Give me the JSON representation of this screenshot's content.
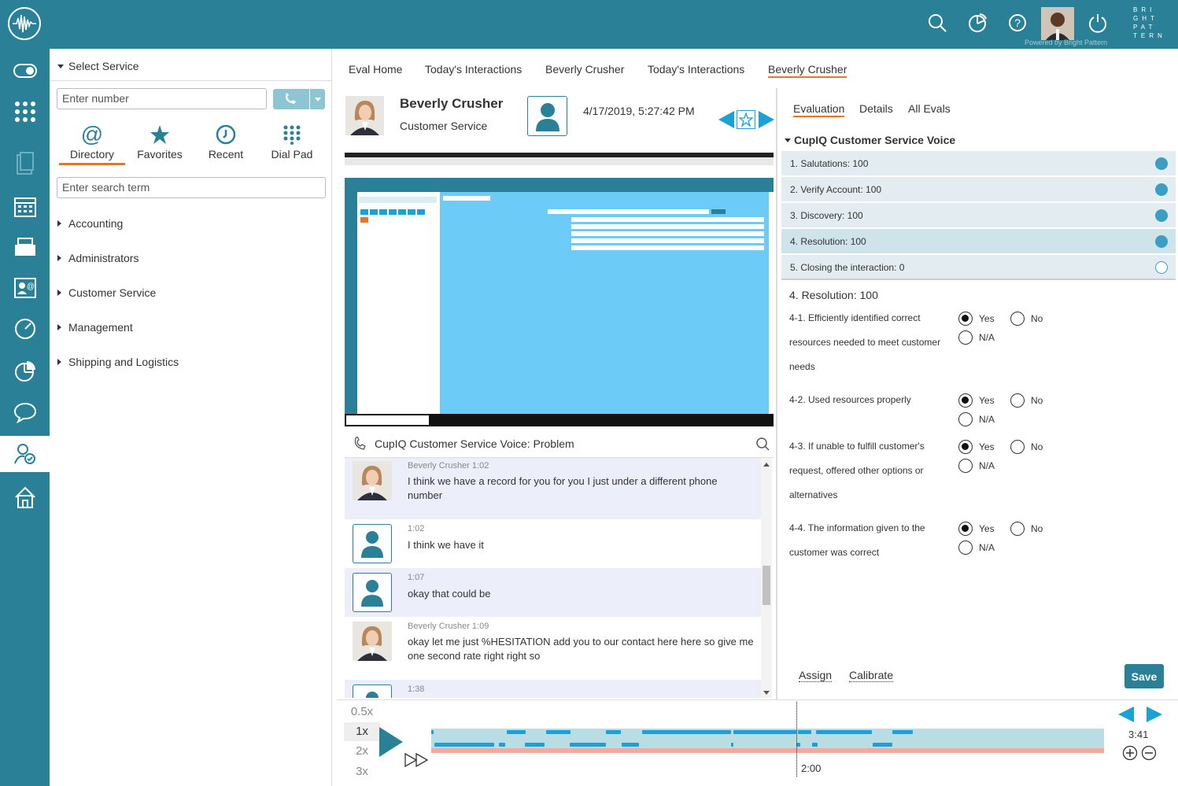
{
  "brand": {
    "logo_text": [
      "BRI",
      "GHT",
      "PAT",
      "TERN"
    ],
    "powered_by": "Powered by Bright Pattern"
  },
  "directory": {
    "select_service": "Select Service",
    "number_placeholder": "Enter number",
    "search_placeholder": "Enter search term",
    "tabs": [
      {
        "label": "Directory",
        "icon": "at-icon"
      },
      {
        "label": "Favorites",
        "icon": "star-icon"
      },
      {
        "label": "Recent",
        "icon": "recent-icon"
      },
      {
        "label": "Dial Pad",
        "icon": "dialpad-icon"
      }
    ],
    "items": [
      "Accounting",
      "Administrators",
      "Customer Service",
      "Management",
      "Shipping and Logistics"
    ]
  },
  "nav_tabs": [
    "Eval Home",
    "Today's Interactions",
    "Beverly Crusher",
    "Today's Interactions",
    "Beverly Crusher"
  ],
  "agent": {
    "name": "Beverly Crusher",
    "team": "Customer Service",
    "datetime": "4/17/2019, 5:27:42 PM"
  },
  "interaction": {
    "title": "CupIQ Customer Service Voice: Problem"
  },
  "transcript": [
    {
      "who": "Beverly Crusher 1:02",
      "text": "I think we have a record for you for you I just under a different phone number",
      "agent": true
    },
    {
      "who": "1:02",
      "text": "I think we have it",
      "agent": false
    },
    {
      "who": "1:07",
      "text": "okay that could be",
      "agent": false
    },
    {
      "who": "Beverly Crusher 1:09",
      "text": "okay let me just %HESITATION add you to our contact here here so give me one second rate right right so",
      "agent": true
    },
    {
      "who": "1:38",
      "text": "",
      "agent": false
    }
  ],
  "eval": {
    "tabs": [
      "Evaluation",
      "Details",
      "All Evals"
    ],
    "form_title": "CupIQ Customer Service Voice",
    "sections": [
      {
        "label": "1. Salutations: 100",
        "filled": true
      },
      {
        "label": "2. Verify Account: 100",
        "filled": true
      },
      {
        "label": "3. Discovery: 100",
        "filled": true
      },
      {
        "label": "4. Resolution: 100",
        "filled": true
      },
      {
        "label": "5. Closing the interaction: 0",
        "filled": false
      }
    ],
    "section_header": "4. Resolution: 100",
    "questions": [
      "4-1. Efficiently identified correct resources needed to meet customer needs",
      "4-2. Used resources properly",
      "4-3. If unable to fulfill customer's request, offered other options or alternatives",
      "4-4. The information given to the customer was correct"
    ],
    "options": {
      "yes": "Yes",
      "no": "No",
      "na": "N/A"
    },
    "assign": "Assign",
    "calibrate": "Calibrate",
    "save": "Save"
  },
  "player": {
    "speeds": [
      "0.5x",
      "1x",
      "2x",
      "3x"
    ],
    "selected_speed": "1x",
    "duration": "3:41",
    "cursor_time": "2:00"
  },
  "colors": {
    "brand": "#2a8197",
    "accent": "#e87722",
    "track": "#b9dde4",
    "segment": "#1aa1d6",
    "save": "#2a8197"
  }
}
